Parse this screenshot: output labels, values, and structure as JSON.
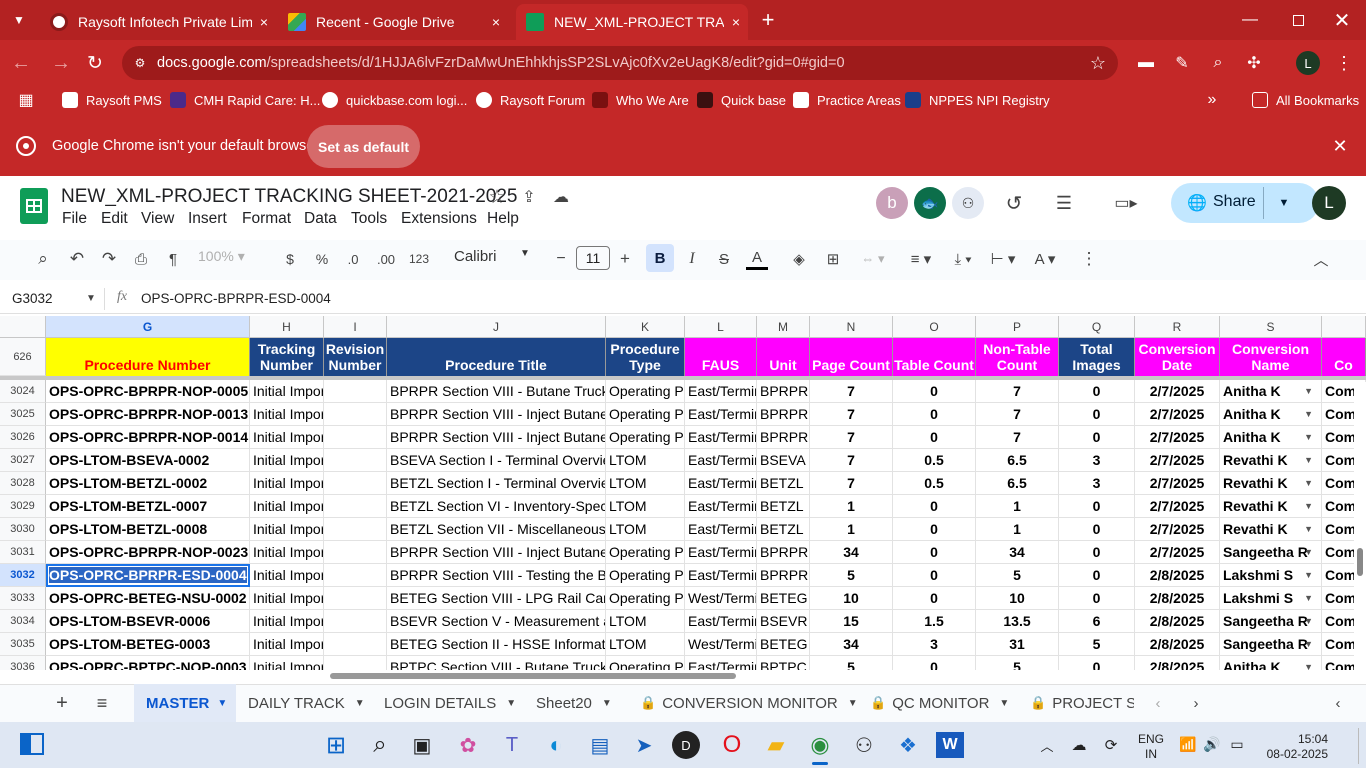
{
  "browser": {
    "tabs": [
      {
        "title": "Raysoft Infotech Private Limited",
        "close_icon": "×"
      },
      {
        "title": "Recent - Google Drive",
        "close_icon": "×"
      },
      {
        "title": "NEW_XML-PROJECT TRACKING",
        "close_icon": "×"
      }
    ],
    "new_tab_icon": "+",
    "url_domain": "docs.google.com",
    "url_path": "/spreadsheets/d/1HJJA6lvFzrDaMwUnEhhkhjsSP2SLvAjc0fXv2eUagK8/edit?gid=0#gid=0",
    "profile_initial": "L",
    "bookmarks": [
      "Raysoft PMS",
      "CMH Rapid Care: H...",
      "quickbase.com logi...",
      "Raysoft Forum",
      "Who We Are",
      "Quick base",
      "Practice Areas",
      "NPPES NPI Registry"
    ],
    "all_bookmarks": "All Bookmarks",
    "infobar_text": "Google Chrome isn't your default browser",
    "set_default_label": "Set as default"
  },
  "sheets": {
    "doc_title": "NEW_XML-PROJECT TRACKING SHEET-2021-2025",
    "menus": [
      "File",
      "Edit",
      "View",
      "Insert",
      "Format",
      "Data",
      "Tools",
      "Extensions",
      "Help"
    ],
    "collab_initial": "b",
    "share_label": "Share",
    "account_initial": "L",
    "zoom": "100%",
    "currency": "$",
    "percent": "%",
    "dec_dec": ".0",
    "dec_inc": ".00",
    "num_format": "123",
    "font": "Calibri",
    "font_size": "11",
    "name_box": "G3032",
    "formula": "OPS-OPRC-BPRPR-ESD-0004",
    "frozen_row_label": "626",
    "column_letters": [
      "G",
      "H",
      "I",
      "J",
      "K",
      "L",
      "M",
      "N",
      "O",
      "P",
      "Q",
      "R",
      "S"
    ],
    "header_cells": [
      "Procedure Number",
      "Tracking Number",
      "Revision Number",
      "Procedure Title",
      "Procedure Type",
      "FAUS",
      "Unit",
      "Page Count",
      "Table Count",
      "Non-Table Count",
      "Total Images",
      "Conversion Date",
      "Conversion Name",
      "Co"
    ],
    "rows": [
      {
        "n": "3024",
        "g": "OPS-OPRC-BPRPR-NOP-0005",
        "h": "Initial Impor",
        "i": "",
        "j": "BPRPR Section VIII - Butane Truck Ur",
        "k": "Operating Pr",
        "l": "East/Termir",
        "m": "BPRPR",
        "pn": "7",
        "o": "0",
        "p": "7",
        "q": "0",
        "r": "2/7/2025",
        "s": "Anitha K",
        "t": "Com"
      },
      {
        "n": "3025",
        "g": "OPS-OPRC-BPRPR-NOP-0013",
        "h": "Initial Impor",
        "i": "",
        "j": "BPRPR Section VIII - Inject Butane fro",
        "k": "Operating Pr",
        "l": "East/Termir",
        "m": "BPRPR",
        "pn": "7",
        "o": "0",
        "p": "7",
        "q": "0",
        "r": "2/7/2025",
        "s": "Anitha K",
        "t": "Com"
      },
      {
        "n": "3026",
        "g": "OPS-OPRC-BPRPR-NOP-0014",
        "h": "Initial Impor",
        "i": "",
        "j": "BPRPR Section VIII - Inject Butane fro",
        "k": "Operating Pr",
        "l": "East/Termir",
        "m": "BPRPR",
        "pn": "7",
        "o": "0",
        "p": "7",
        "q": "0",
        "r": "2/7/2025",
        "s": "Anitha K",
        "t": "Com"
      },
      {
        "n": "3027",
        "g": "OPS-LTOM-BSEVA-0002",
        "h": "Initial Impor",
        "i": "",
        "j": "BSEVA Section I - Terminal Overview",
        "k": "LTOM",
        "l": "East/Termir",
        "m": "BSEVA",
        "pn": "7",
        "o": "0.5",
        "p": "6.5",
        "q": "3",
        "r": "2/7/2025",
        "s": "Revathi K",
        "t": "Com"
      },
      {
        "n": "3028",
        "g": "OPS-LTOM-BETZL-0002",
        "h": "Initial Impor",
        "i": "",
        "j": "BETZL Section I - Terminal Overview",
        "k": "LTOM",
        "l": "East/Termir",
        "m": "BETZL",
        "pn": "7",
        "o": "0.5",
        "p": "6.5",
        "q": "3",
        "r": "2/7/2025",
        "s": "Revathi K",
        "t": "Com"
      },
      {
        "n": "3029",
        "g": "OPS-LTOM-BETZL-0007",
        "h": "Initial Impor",
        "i": "",
        "j": "BETZL Section VI - Inventory-Specific",
        "k": "LTOM",
        "l": "East/Termir",
        "m": "BETZL",
        "pn": "1",
        "o": "0",
        "p": "1",
        "q": "0",
        "r": "2/7/2025",
        "s": "Revathi K",
        "t": "Com"
      },
      {
        "n": "3030",
        "g": "OPS-LTOM-BETZL-0008",
        "h": "Initial Impor",
        "i": "",
        "j": "BETZL Section VII - Miscellaneous",
        "k": "LTOM",
        "l": "East/Termir",
        "m": "BETZL",
        "pn": "1",
        "o": "0",
        "p": "1",
        "q": "0",
        "r": "2/7/2025",
        "s": "Revathi K",
        "t": "Com"
      },
      {
        "n": "3031",
        "g": "OPS-OPRC-BPRPR-NOP-0023",
        "h": "Initial Impor",
        "i": "",
        "j": "BPRPR Section VIII - Inject Butane fro",
        "k": "Operating Pr",
        "l": "East/Termir",
        "m": "BPRPR",
        "pn": "34",
        "o": "0",
        "p": "34",
        "q": "0",
        "r": "2/7/2025",
        "s": "Sangeetha R",
        "t": "Com"
      },
      {
        "n": "3032",
        "g": "OPS-OPRC-BPRPR-ESD-0004",
        "h": "Initial Impor",
        "i": "",
        "j": "BPRPR Section VIII - Testing the Buta",
        "k": "Operating Pr",
        "l": "East/Termir",
        "m": "BPRPR",
        "pn": "5",
        "o": "0",
        "p": "5",
        "q": "0",
        "r": "2/8/2025",
        "s": "Lakshmi S",
        "t": "Com"
      },
      {
        "n": "3033",
        "g": "OPS-OPRC-BETEG-NSU-0002",
        "h": "Initial Impor",
        "i": "",
        "j": "BETEG Section VIII - LPG Rail Car Loa",
        "k": "Operating Pr",
        "l": "West/Termi",
        "m": "BETEG",
        "pn": "10",
        "o": "0",
        "p": "10",
        "q": "0",
        "r": "2/8/2025",
        "s": "Lakshmi S",
        "t": "Com"
      },
      {
        "n": "3034",
        "g": "OPS-LTOM-BSEVR-0006",
        "h": "Initial Impor",
        "i": "",
        "j": "BSEVR Section V - Measurement anc",
        "k": "LTOM",
        "l": "East/Termir",
        "m": "BSEVR",
        "pn": "15",
        "o": "1.5",
        "p": "13.5",
        "q": "6",
        "r": "2/8/2025",
        "s": "Sangeetha R",
        "t": "Com"
      },
      {
        "n": "3035",
        "g": "OPS-LTOM-BETEG-0003",
        "h": "Initial Impor",
        "i": "",
        "j": "BETEG Section II - HSSE Information",
        "k": "LTOM",
        "l": "West/Termi",
        "m": "BETEG",
        "pn": "34",
        "o": "3",
        "p": "31",
        "q": "5",
        "r": "2/8/2025",
        "s": "Sangeetha R",
        "t": "Com"
      },
      {
        "n": "3036",
        "g": "OPS-OPRC-BPTPC-NOP-0003",
        "h": "Initial Impor",
        "i": "",
        "j": "BPTPC Section VIII - Butane Truck Ur",
        "k": "Operating Pr",
        "l": "East/Termir",
        "m": "BPTPC",
        "pn": "5",
        "o": "0",
        "p": "5",
        "q": "0",
        "r": "2/8/2025",
        "s": "Anitha K",
        "t": "Com"
      }
    ],
    "sheet_tabs": [
      "MASTER",
      "DAILY TRACK",
      "LOGIN DETAILS",
      "Sheet20",
      "CONVERSION MONITOR",
      "QC MONITOR",
      "PROJECT SU"
    ]
  },
  "taskbar": {
    "lang": "ENG",
    "region": "IN",
    "time": "15:04",
    "date": "08-02-2025"
  },
  "colors": {
    "chrome_red": "#c42828",
    "header_yellow": "#ffff00",
    "header_blue": "#1c4587",
    "header_magenta": "#ff00ff",
    "procedure_text_red": "#ff0000",
    "selection_blue": "#1a73e8"
  }
}
